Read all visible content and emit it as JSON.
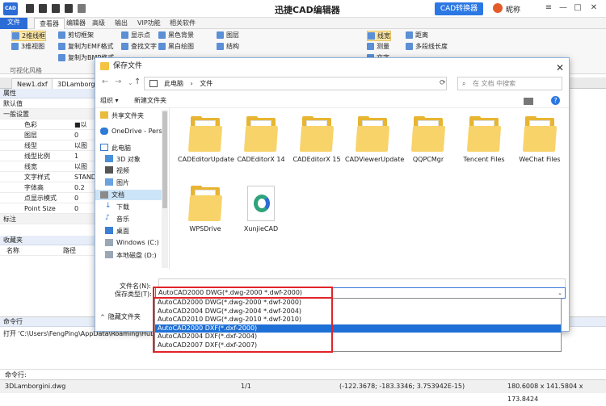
{
  "app": {
    "logo": "CAD",
    "title": "迅捷CAD编辑器",
    "convert_button": "CAD转换器",
    "user": "昵称"
  },
  "menu_tabs": [
    "文件",
    "查看器",
    "编辑器",
    "高级",
    "输出",
    "VIP功能",
    "相关软件"
  ],
  "ribbon": {
    "view2d": "2维线框",
    "view3d": "3维视图",
    "cut_frame": "剪切框架",
    "copy_emf": "复制为EMF格式",
    "copy_bmp": "复制为BMP格式",
    "show_points": "显示点",
    "find_text": "查找文字",
    "black_bg": "黑色背景",
    "bw_draw": "黑白绘图",
    "layers": "图层",
    "structure": "结构",
    "line_width": "线宽",
    "measure": "测量",
    "distance": "距离",
    "polyline_length": "多段线长度",
    "text": "文字",
    "group_label": "可视化风格"
  },
  "doc_tabs": [
    "New1.dxf",
    "3DLamborgini"
  ],
  "properties": {
    "title": "属性",
    "default": "默认值",
    "section_general": "一般设置",
    "rows": [
      {
        "k": "色彩",
        "v": "■以"
      },
      {
        "k": "图层",
        "v": "0"
      },
      {
        "k": "线型",
        "v": "以图"
      },
      {
        "k": "线型比例",
        "v": "1"
      },
      {
        "k": "线宽",
        "v": "以图"
      },
      {
        "k": "文字样式",
        "v": "STAND"
      },
      {
        "k": "字体高",
        "v": "0.2"
      },
      {
        "k": "点显示模式",
        "v": "0"
      },
      {
        "k": "Point Size",
        "v": "0"
      }
    ],
    "section_annot": "标注"
  },
  "favorites": {
    "title": "收藏夹",
    "col_name": "名称",
    "col_path": "路径"
  },
  "command": {
    "title": "命令行",
    "log": "打开 'C:\\Users\\FengPing\\AppData\\Roaming\\HuDun\\XunjieCAD",
    "prompt": "命令行:"
  },
  "statusbar": {
    "file": "3DLamborgini.dwg",
    "page": "1/1",
    "coords": "(-122.3678; -183.3346; 3.753942E-15)",
    "size": "180.6008 x 141.5804 x 173.8424"
  },
  "dialog": {
    "title": "保存文件",
    "address": [
      "此电脑",
      "文件"
    ],
    "search_placeholder": "在 文档 中搜索",
    "organize": "组织 ▾",
    "new_folder": "新建文件夹",
    "nav": [
      "共享文件夹",
      "OneDrive - Perso",
      "此电脑",
      "3D 对象",
      "视频",
      "图片",
      "文档",
      "下载",
      "音乐",
      "桌面",
      "Windows (C:)",
      "本地磁盘 (D:)"
    ],
    "files": [
      {
        "name": "CADEditorUpdate",
        "type": "folder"
      },
      {
        "name": "CADEditorX 14",
        "type": "folder"
      },
      {
        "name": "CADEditorX 15",
        "type": "folder"
      },
      {
        "name": "CADViewerUpdate",
        "type": "folder"
      },
      {
        "name": "QQPCMgr",
        "type": "folder"
      },
      {
        "name": "Tencent Files",
        "type": "folder"
      },
      {
        "name": "WeChat Files",
        "type": "folder"
      },
      {
        "name": "WPSDrive",
        "type": "folder"
      },
      {
        "name": "XunjieCAD",
        "type": "app-file"
      }
    ],
    "filename_label": "文件名(N):",
    "filename_value": "",
    "filetype_label": "保存类型(T):",
    "filetype_value": "AutoCAD2000 DWG(*.dwg-2000 *.dwf-2000)",
    "hide_folders": "隐藏文件夹",
    "filetype_options": [
      "AutoCAD2000 DWG(*.dwg-2000 *.dwf-2000)",
      "AutoCAD2004 DWG(*.dwg-2004 *.dwf-2004)",
      "AutoCAD2010 DWG(*.dwg-2010 *.dwf-2010)",
      "AutoCAD2000 DXF(*.dxf-2000)",
      "AutoCAD2004 DXF(*.dxf-2004)",
      "AutoCAD2007 DXF(*.dxf-2007)"
    ],
    "selected_option_index": 3
  }
}
